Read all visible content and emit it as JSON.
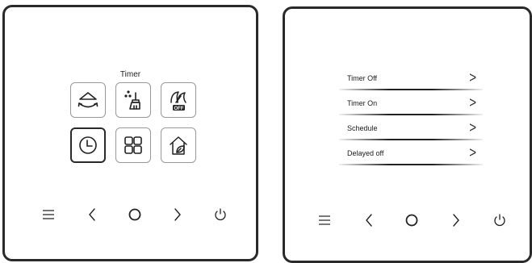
{
  "left_panel": {
    "title": "Timer",
    "icons": [
      {
        "name": "swing-icon",
        "selected": false
      },
      {
        "name": "clean-icon",
        "selected": false
      },
      {
        "name": "eco-icon",
        "badge": "OFF",
        "selected": false
      },
      {
        "name": "timer-icon",
        "selected": true
      },
      {
        "name": "grid-menu-icon",
        "selected": false
      },
      {
        "name": "home-leaf-icon",
        "selected": false
      }
    ]
  },
  "right_panel": {
    "menu_items": [
      {
        "label": "Timer Off"
      },
      {
        "label": "Timer On"
      },
      {
        "label": "Schedule"
      },
      {
        "label": "Delayed off"
      }
    ],
    "chevron": ">"
  },
  "nav_icons": [
    "menu-icon",
    "back-icon",
    "home-circle-icon",
    "forward-icon",
    "power-icon"
  ]
}
